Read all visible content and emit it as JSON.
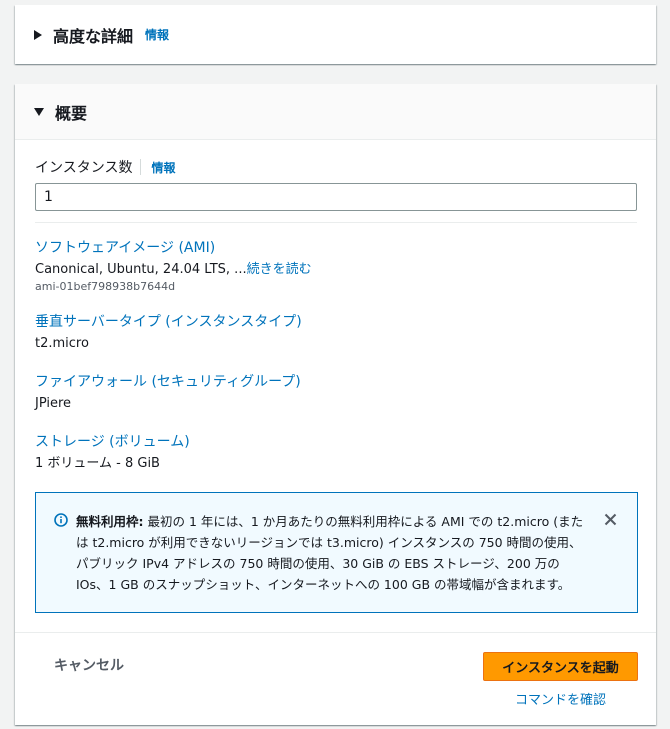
{
  "advanced": {
    "title": "高度な詳細",
    "info": "情報"
  },
  "summary": {
    "title": "概要",
    "instance_count": {
      "label": "インスタンス数",
      "info": "情報",
      "value": "1"
    },
    "ami": {
      "label": "ソフトウェアイメージ (AMI)",
      "value": "Canonical, Ubuntu, 24.04 LTS, ...",
      "more": "続きを読む",
      "id": "ami-01bef798938b7644d"
    },
    "instance_type": {
      "label": "垂直サーバータイプ (インスタンスタイプ)",
      "value": "t2.micro"
    },
    "firewall": {
      "label": "ファイアウォール (セキュリティグループ)",
      "value": "JPiere"
    },
    "storage": {
      "label": "ストレージ (ボリューム)",
      "value": "1 ボリューム - 8 GiB"
    },
    "alert": {
      "heading": "無料利用枠:",
      "text": " 最初の 1 年には、1 か月あたりの無料利用枠による AMI での t2.micro (または t2.micro が利用できないリージョンでは t3.micro) インスタンスの 750 時間の使用、パブリック IPv4 アドレスの 750 時間の使用、30 GiB の EBS ストレージ、200 万の IOs、1 GB のスナップショット、インターネットへの 100 GB の帯域幅が含まれます。"
    }
  },
  "footer": {
    "cancel": "キャンセル",
    "launch": "インスタンスを起動",
    "review": "コマンドを確認"
  },
  "colors": {
    "link": "#0073bb",
    "primary_button": "#ff9900",
    "alert_border": "#0073bb",
    "alert_bg": "#f1faff"
  }
}
